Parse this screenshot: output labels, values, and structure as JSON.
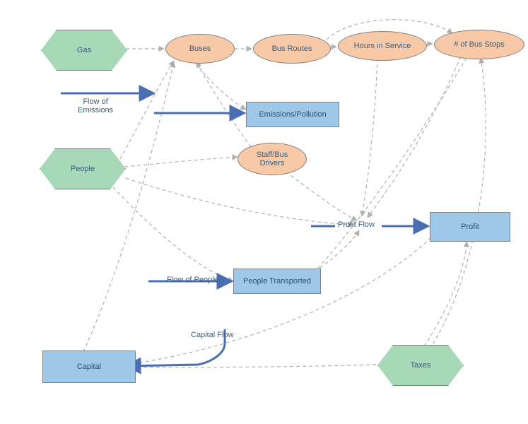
{
  "nodes": {
    "gas": {
      "label": "Gas"
    },
    "people": {
      "label": "People"
    },
    "taxes": {
      "label": "Taxes"
    },
    "buses": {
      "label": "Buses"
    },
    "busroutes": {
      "label": "Bus Routes"
    },
    "hours": {
      "label": "Hours in Service"
    },
    "stops": {
      "label": "# of Bus Stops"
    },
    "staff": {
      "label": "Staff/Bus\nDrivers"
    },
    "emissions": {
      "label": "Emissions/Pollution"
    },
    "profit": {
      "label": "Profit"
    },
    "transported": {
      "label": "People Transported"
    },
    "capital": {
      "label": "Capital"
    }
  },
  "flows": {
    "emissionsFlow": {
      "label": "Flow of\nEmissions"
    },
    "peopleFlow": {
      "label": "Flow of People"
    },
    "profitFlow": {
      "label": "Profit Flow"
    },
    "capitalFlow": {
      "label": "Capital Flow"
    }
  }
}
